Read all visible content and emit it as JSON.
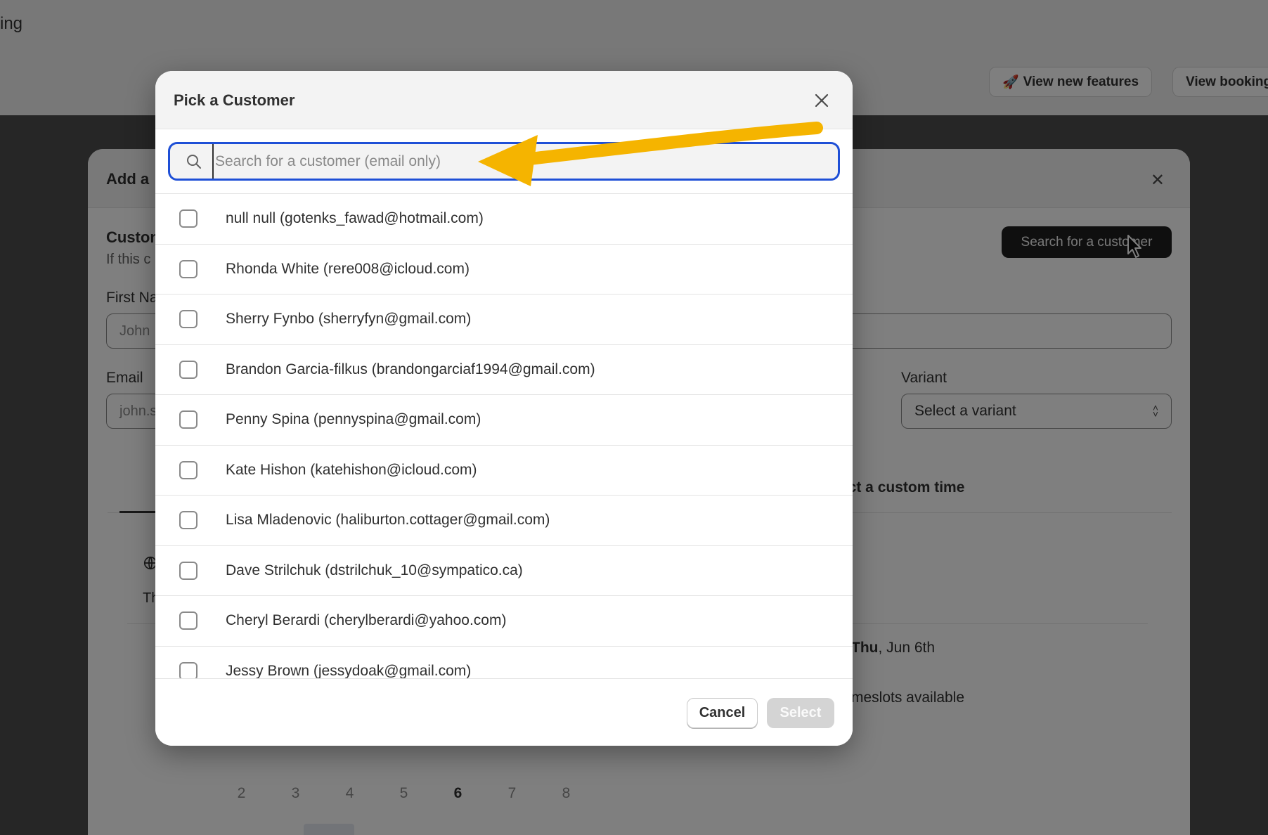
{
  "background": {
    "page_title_fragment": "ing",
    "header_buttons": [
      {
        "icon": "rocket-icon",
        "glyph": "🚀",
        "label": "View new features"
      },
      {
        "label": "View booking"
      }
    ],
    "modal": {
      "title_fragment": "Add a",
      "section_title_fragment": "Custom",
      "section_sub_fragment": "If this c",
      "search_customer_label": "Search for a customer",
      "first_name_label_fragment": "First Na",
      "first_name_value_fragment": "John",
      "email_label": "Email",
      "email_value_fragment": "john.s",
      "variant_label": "Variant",
      "variant_select_value": "Select a variant",
      "custom_time_tab_fragment": "ect a custom time",
      "timezone_fragment": "Th",
      "selected_date": {
        "day": "Thu",
        "rest": ", Jun 6th"
      },
      "slots_fragment": "meslots available",
      "calendar_days": [
        "2",
        "3",
        "4",
        "5",
        "6",
        "7",
        "8"
      ],
      "calendar_current": "6"
    }
  },
  "dialog": {
    "title": "Pick a Customer",
    "search": {
      "placeholder": "Search for a customer (email only)",
      "value": ""
    },
    "customers": [
      {
        "label": "null null (gotenks_fawad@hotmail.com)",
        "checked": false
      },
      {
        "label": "Rhonda White (rere008@icloud.com)",
        "checked": false
      },
      {
        "label": "Sherry Fynbo (sherryfyn@gmail.com)",
        "checked": false
      },
      {
        "label": "Brandon Garcia-filkus (brandongarciaf1994@gmail.com)",
        "checked": false
      },
      {
        "label": "Penny Spina (pennyspina@gmail.com)",
        "checked": false
      },
      {
        "label": "Kate Hishon (katehishon@icloud.com)",
        "checked": false
      },
      {
        "label": "Lisa Mladenovic (haliburton.cottager@gmail.com)",
        "checked": false
      },
      {
        "label": "Dave Strilchuk (dstrilchuk_10@sympatico.ca)",
        "checked": false
      },
      {
        "label": "Cheryl Berardi (cherylberardi@yahoo.com)",
        "checked": false
      },
      {
        "label": "Jessy Brown (jessydoak@gmail.com)",
        "checked": false
      }
    ],
    "cancel_label": "Cancel",
    "select_label": "Select"
  },
  "colors": {
    "accent_focus": "#1e4fd6",
    "annotation_arrow": "#f5b400",
    "primary_dark": "#1f1f1f",
    "disabled_button": "#d4d4d4"
  }
}
